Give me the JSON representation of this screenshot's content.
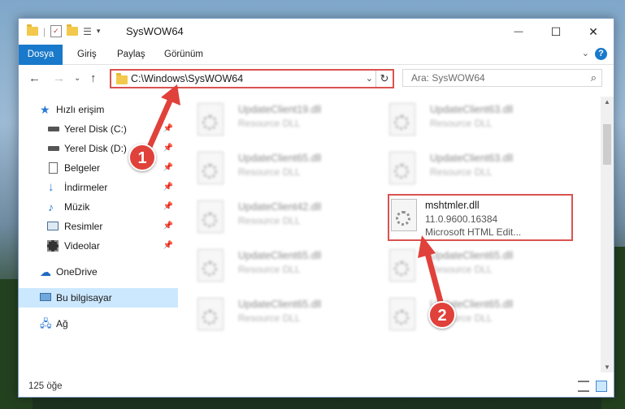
{
  "window": {
    "title": "SysWOW64",
    "minimize_glyph": "—",
    "maximize_glyph": "☐",
    "close_glyph": "✕"
  },
  "ribbon": {
    "tabs": [
      "Dosya",
      "Giriş",
      "Paylaş",
      "Görünüm"
    ]
  },
  "nav": {
    "address": "C:\\Windows\\SysWOW64",
    "search_placeholder": "Ara: SysWOW64"
  },
  "sidebar": {
    "items": [
      {
        "label": "Hızlı erişim",
        "icon": "star-icon"
      },
      {
        "label": "Yerel Disk (C:)",
        "icon": "drive-icon",
        "pinned": true
      },
      {
        "label": "Yerel Disk (D:)",
        "icon": "drive-icon",
        "pinned": true
      },
      {
        "label": "Belgeler",
        "icon": "documents-icon",
        "pinned": true
      },
      {
        "label": "İndirmeler",
        "icon": "download-icon",
        "pinned": true
      },
      {
        "label": "Müzik",
        "icon": "music-icon",
        "pinned": true
      },
      {
        "label": "Resimler",
        "icon": "pictures-icon",
        "pinned": true
      },
      {
        "label": "Videolar",
        "icon": "videos-icon",
        "pinned": true
      },
      {
        "label": "OneDrive",
        "icon": "cloud-icon"
      },
      {
        "label": "Bu bilgisayar",
        "icon": "computer-icon",
        "selected": true
      },
      {
        "label": "Ağ",
        "icon": "network-icon"
      }
    ]
  },
  "files": [
    {
      "name": "UpdateClient19.dll",
      "desc": "Resource DLL"
    },
    {
      "name": "UpdateClient63.dll",
      "desc": "Resource DLL"
    },
    {
      "name": "UpdateClient65.dll",
      "desc": "Resource DLL"
    },
    {
      "name": "UpdateClient63.dll",
      "desc": "Resource DLL"
    },
    {
      "name": "UpdateClient42.dll",
      "desc": "Resource DLL"
    },
    {
      "name": "mshtmler.dll",
      "version": "11.0.9600.16384",
      "desc": "Microsoft HTML Edit..."
    },
    {
      "name": "UpdateClient65.dll",
      "desc": "Resource DLL"
    },
    {
      "name": "UpdateClient65.dll",
      "desc": "Resource DLL"
    },
    {
      "name": "UpdateClient65.dll",
      "desc": "Resource DLL"
    },
    {
      "name": "UpdateClient65.dll",
      "desc": "Resource DLL"
    }
  ],
  "status": {
    "count": "125 öğe"
  },
  "annotations": {
    "step1": "1",
    "step2": "2",
    "color": "#e0413a"
  }
}
